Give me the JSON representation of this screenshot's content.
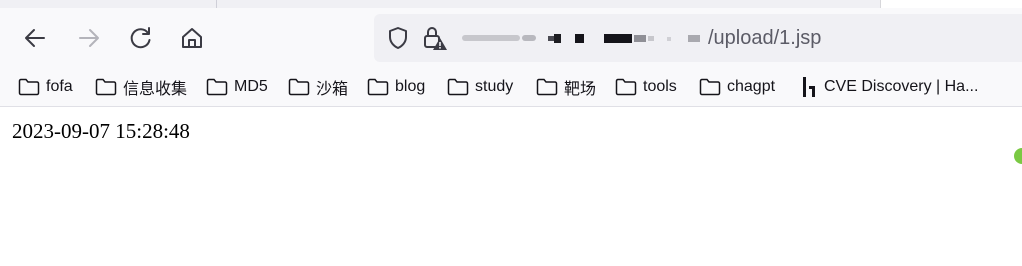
{
  "browser": {
    "url_visible": "/upload/1.jsp",
    "icons": {
      "back": "back-arrow-icon",
      "forward": "forward-arrow-icon",
      "reload": "reload-icon",
      "home": "home-icon",
      "tracking": "shield-icon",
      "security": "lock-warning-icon",
      "bookmark_folder": "folder-icon",
      "site_favicon": "hackerone-logo-icon"
    }
  },
  "bookmarks": [
    {
      "label": "fofa"
    },
    {
      "label": "信息收集"
    },
    {
      "label": "MD5"
    },
    {
      "label": "沙箱"
    },
    {
      "label": "blog"
    },
    {
      "label": "study"
    },
    {
      "label": "靶场"
    },
    {
      "label": "tools"
    },
    {
      "label": "chagpt"
    },
    {
      "label": "CVE Discovery | Ha..."
    }
  ],
  "page": {
    "text": "2023-09-07 15:28:48"
  }
}
